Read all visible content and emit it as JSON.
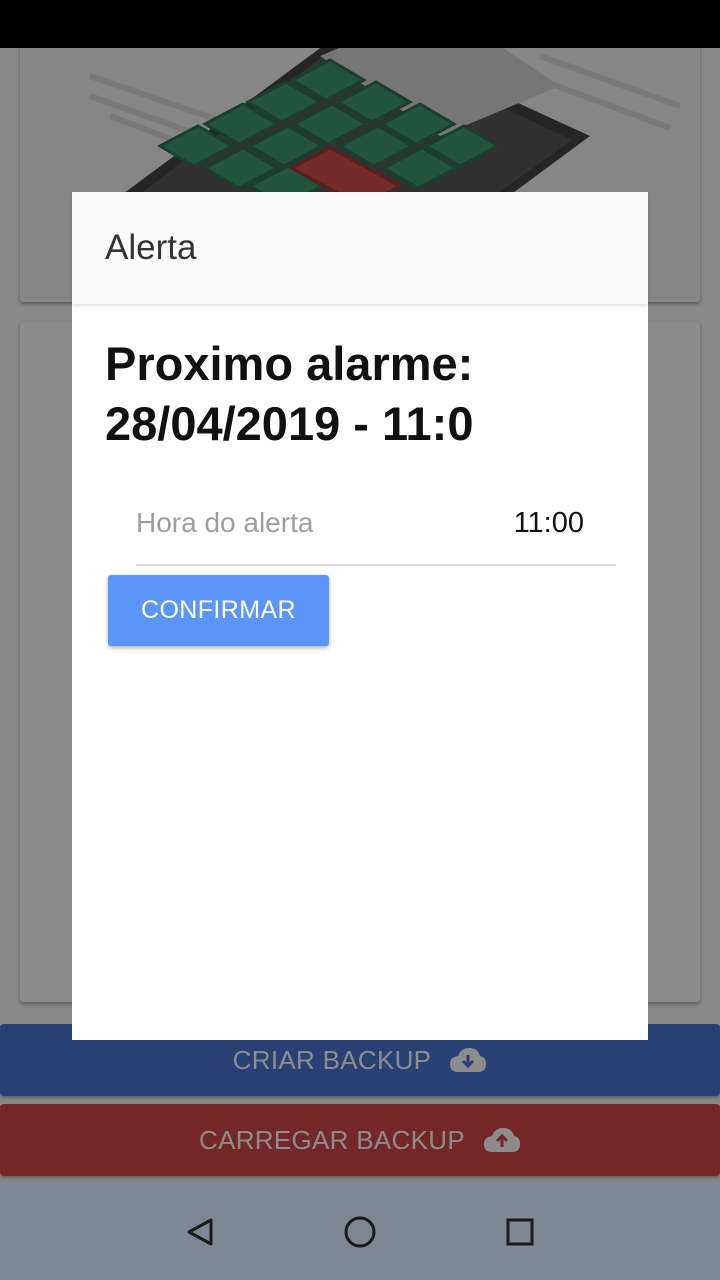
{
  "dialog": {
    "title": "Alerta",
    "heading": "Proximo alarme:\n28/04/2019 - 11:0",
    "field": {
      "label": "Hora do alerta",
      "value": "11:00"
    },
    "confirm_label": "CONFIRMAR"
  },
  "actions": {
    "create_backup": "CRIAR BACKUP",
    "load_backup": "CARREGAR BACKUP"
  },
  "navigation": {
    "back_icon": "back-triangle-icon",
    "home_icon": "home-circle-icon",
    "recents_icon": "recents-square-icon"
  },
  "colors": {
    "create_backup_bg": "#4a76d1",
    "load_backup_bg": "#d64646",
    "confirm_bg": "#5b95f9",
    "nav_bar_bg": "#7d8793"
  }
}
